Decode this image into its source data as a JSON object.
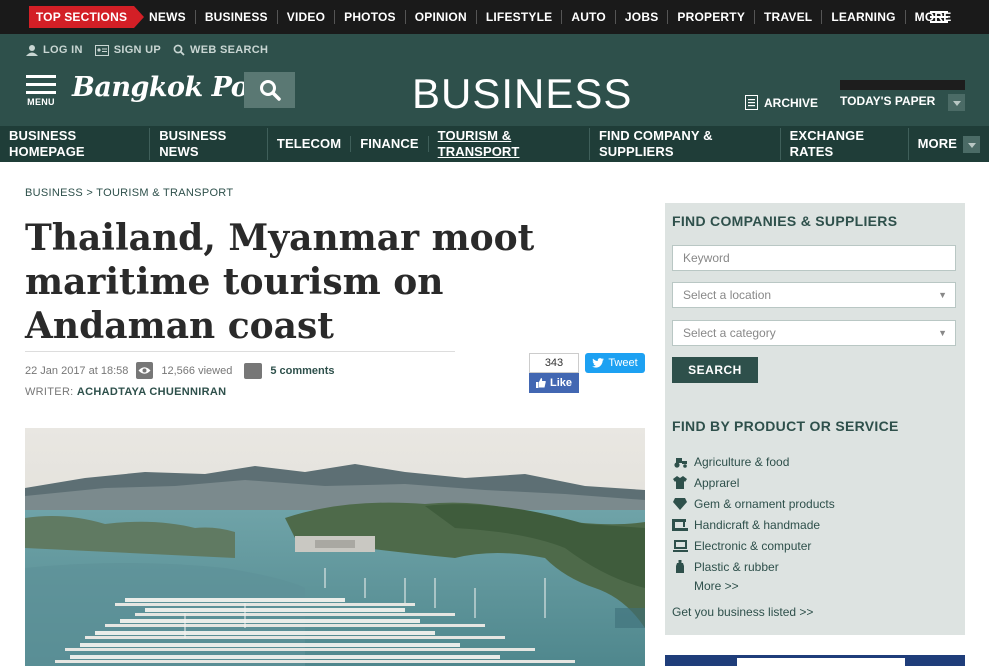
{
  "topbar": {
    "sections_label": "TOP SECTIONS",
    "items": [
      "NEWS",
      "BUSINESS",
      "VIDEO",
      "PHOTOS",
      "OPINION",
      "LIFESTYLE",
      "AUTO",
      "JOBS",
      "PROPERTY",
      "TRAVEL",
      "LEARNING",
      "MORE"
    ]
  },
  "header": {
    "login": "LOG IN",
    "signup": "SIGN UP",
    "websearch": "WEB SEARCH",
    "menu_label": "MENU",
    "logo": "Bangkok Post",
    "section_title": "BUSINESS",
    "archive": "ARCHIVE",
    "todays_paper": "TODAY'S PAPER"
  },
  "business_nav": {
    "items": [
      "BUSINESS HOMEPAGE",
      "BUSINESS NEWS",
      "TELECOM",
      "FINANCE",
      "TOURISM & TRANSPORT",
      "FIND COMPANY & SUPPLIERS",
      "EXCHANGE RATES"
    ],
    "more": "MORE",
    "active": "TOURISM & TRANSPORT"
  },
  "article": {
    "breadcrumb": "BUSINESS > TOURISM & TRANSPORT",
    "headline": "Thailand, Myanmar moot maritime tourism on Andaman coast",
    "date": "22 Jan 2017 at 18:58",
    "views": "12,566 viewed",
    "comments": "5 comments",
    "writer_label": "WRITER:",
    "writer_name": "ACHADTAYA CHUENNIRAN",
    "fb_count": "343",
    "fb_like": "Like",
    "tweet": "Tweet"
  },
  "sidebar": {
    "title": "FIND COMPANIES & SUPPLIERS",
    "keyword_placeholder": "Keyword",
    "location_placeholder": "Select a location",
    "category_placeholder": "Select a category",
    "search_button": "SEARCH",
    "product_title": "FIND BY PRODUCT OR SERVICE",
    "products": [
      {
        "label": "Agriculture & food",
        "icon": "tractor-icon"
      },
      {
        "label": "Apprarel",
        "icon": "shirt-icon"
      },
      {
        "label": "Gem & ornament products",
        "icon": "gem-icon"
      },
      {
        "label": "Handicraft & handmade",
        "icon": "sewing-icon"
      },
      {
        "label": "Electronic & computer",
        "icon": "computer-icon"
      },
      {
        "label": "Plastic & rubber",
        "icon": "bottle-icon"
      }
    ],
    "more": "More >>",
    "get_business": "Get you business listed >>"
  },
  "colors": {
    "header_green": "#2e504b",
    "nav_dark_green": "#1f3d38",
    "accent_red": "#d31f26",
    "sidebar_bg": "#dde3e1"
  }
}
